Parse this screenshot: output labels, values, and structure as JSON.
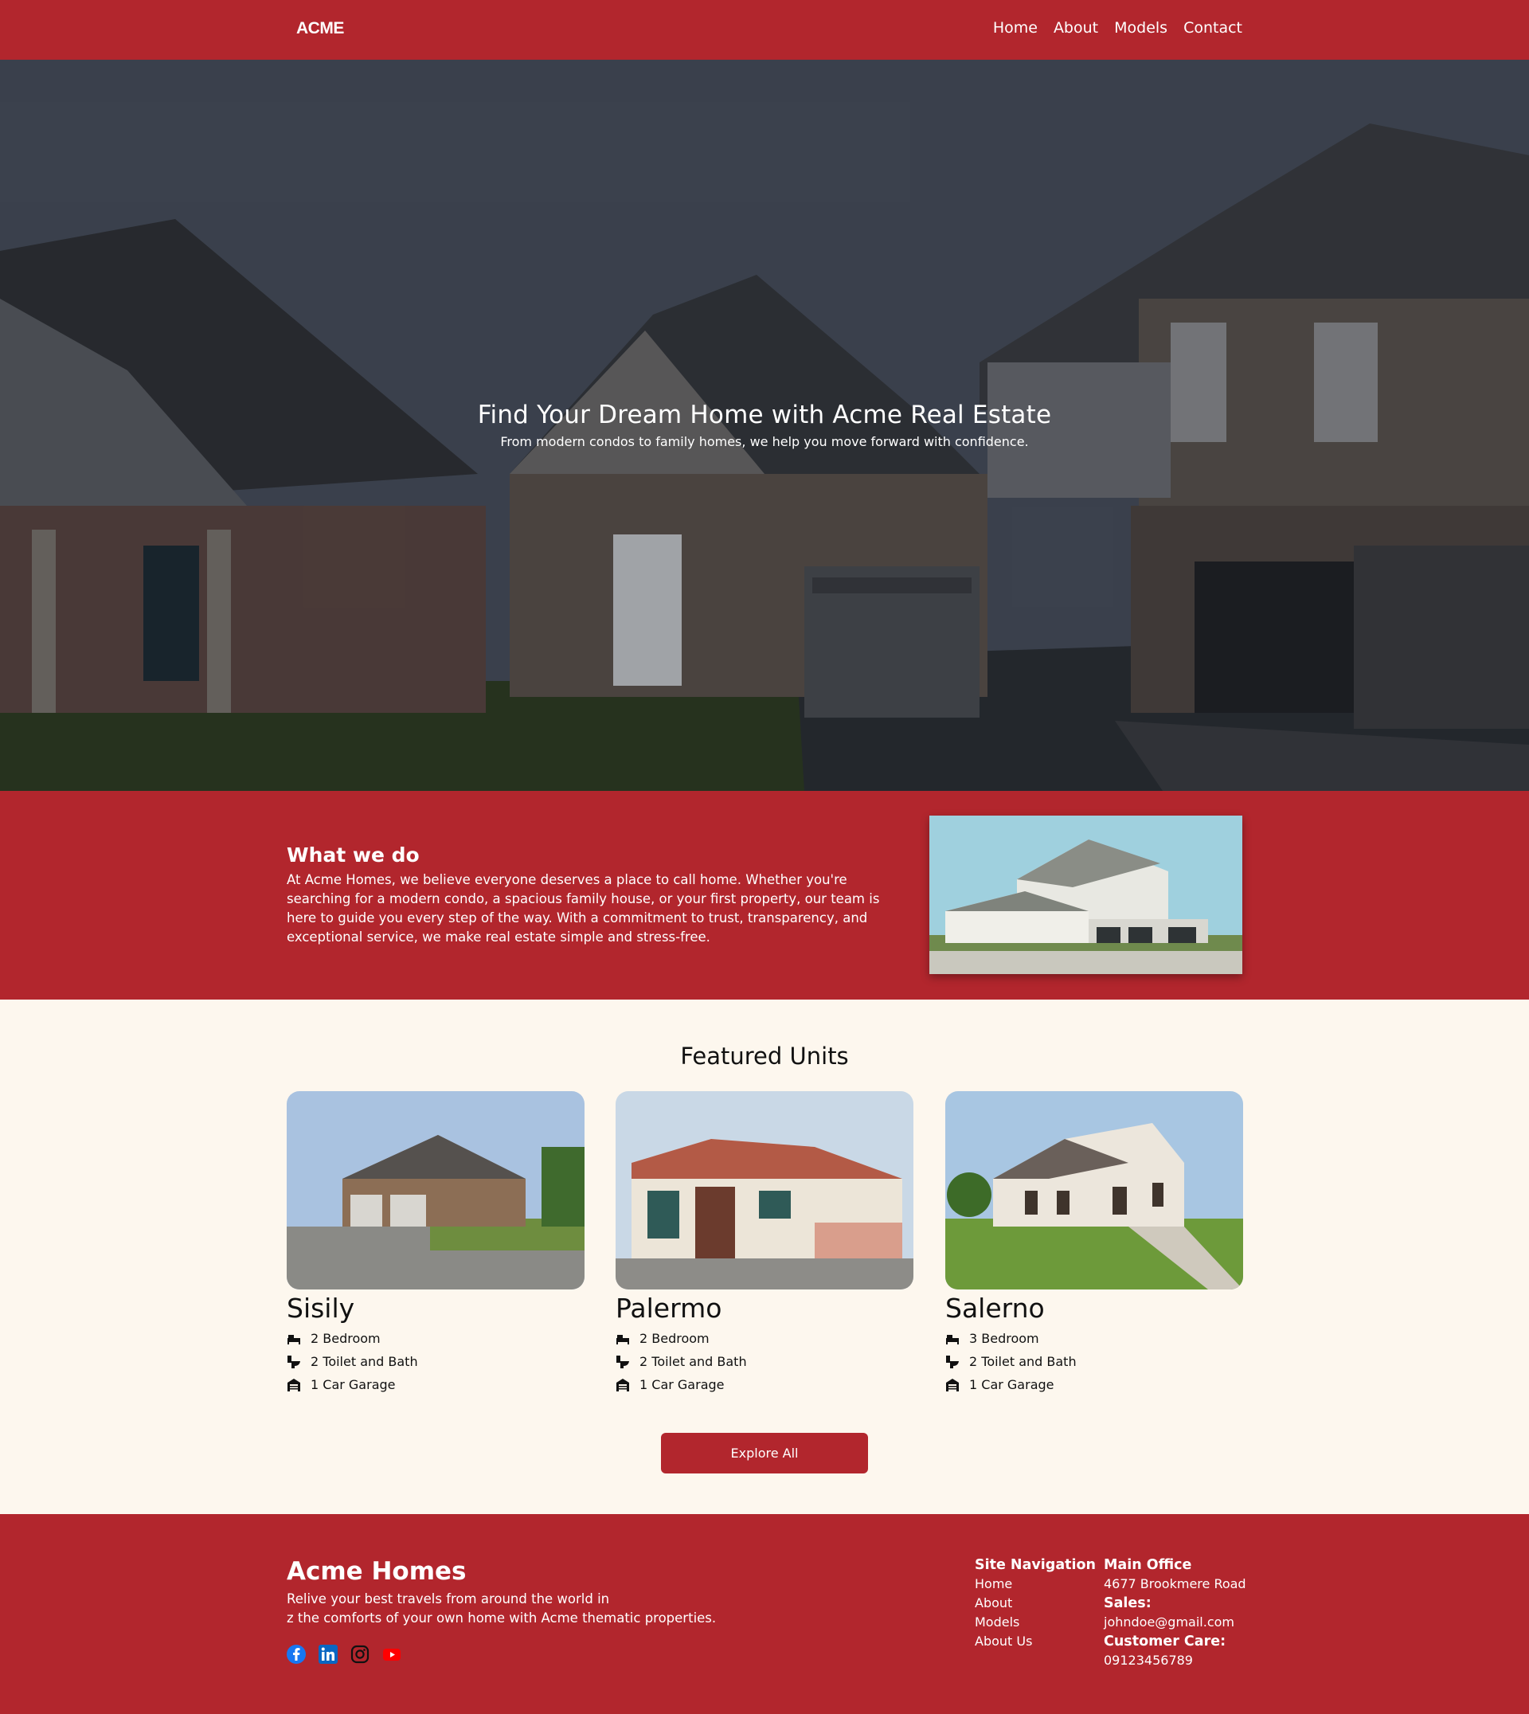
{
  "nav": {
    "logo": "ACME",
    "links": [
      "Home",
      "About",
      "Models",
      "Contact"
    ]
  },
  "hero": {
    "title": "Find Your Dream Home with Acme Real Estate",
    "subtitle": "From modern condos to family homes, we help you move forward with confidence."
  },
  "about": {
    "heading": "What we do",
    "body": "At Acme Homes, we believe everyone deserves a place to call home. Whether you're searching for a modern condo, a spacious family house, or your first property, our team is here to guide you every step of the way. With a commitment to trust, transparency, and exceptional service, we make real estate simple and stress-free."
  },
  "featured": {
    "heading": "Featured Units",
    "units": [
      {
        "name": "Sisily",
        "bedroom": "2 Bedroom",
        "bath": "2 Toilet and Bath",
        "garage": "1 Car Garage"
      },
      {
        "name": "Palermo",
        "bedroom": "2 Bedroom",
        "bath": "2 Toilet and Bath",
        "garage": "1 Car Garage"
      },
      {
        "name": "Salerno",
        "bedroom": "3 Bedroom",
        "bath": "2 Toilet and Bath",
        "garage": "1 Car Garage"
      }
    ],
    "button": "Explore All"
  },
  "footer": {
    "brand": "Acme Homes",
    "tagline_1": "Relive your best travels from around the world in",
    "tagline_2": "z the comforts of your own home with Acme thematic properties.",
    "social_icons": [
      "facebook-icon",
      "linkedin-icon",
      "instagram-icon",
      "youtube-icon"
    ],
    "nav_heading": "Site Navigation",
    "nav_links": [
      "Home",
      "About",
      "Models",
      "About Us"
    ],
    "office_heading": "Main Office",
    "office_address": "4677 Brookmere Road",
    "sales_heading": "Sales:",
    "sales_email": "johndoe@gmail.com",
    "care_heading": "Customer Care:",
    "care_phone": "09123456789"
  },
  "colors": {
    "brand_red": "#b2262d",
    "cream": "#fdf7ee"
  }
}
